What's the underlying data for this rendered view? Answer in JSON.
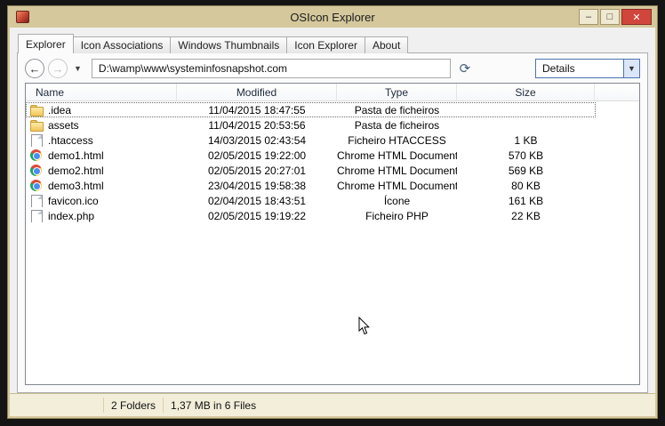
{
  "titlebar": {
    "title": "OSIcon Explorer",
    "minimize_glyph": "–",
    "maximize_glyph": "□",
    "close_glyph": "✕"
  },
  "tabs": [
    {
      "label": "Explorer",
      "active": true
    },
    {
      "label": "Icon Associations",
      "active": false
    },
    {
      "label": "Windows Thumbnails",
      "active": false
    },
    {
      "label": "Icon Explorer",
      "active": false
    },
    {
      "label": "About",
      "active": false
    }
  ],
  "toolbar": {
    "back_glyph": "←",
    "forward_glyph": "→",
    "history_dropdown_glyph": "▼",
    "address": "D:\\wamp\\www\\systeminfosnapshot.com",
    "refresh_glyph": "⟳",
    "view_combo": {
      "value": "Details",
      "arrow_glyph": "▼"
    }
  },
  "list": {
    "columns": [
      "Name",
      "Modified",
      "Type",
      "Size"
    ],
    "rows": [
      {
        "icon": "folder",
        "name": ".idea",
        "modified": "11/04/2015 18:47:55",
        "type": "Pasta de ficheiros",
        "size": "",
        "focused": true
      },
      {
        "icon": "folder",
        "name": "assets",
        "modified": "11/04/2015 20:53:56",
        "type": "Pasta de ficheiros",
        "size": "",
        "focused": false
      },
      {
        "icon": "file",
        "name": ".htaccess",
        "modified": "14/03/2015 02:43:54",
        "type": "Ficheiro HTACCESS",
        "size": "1 KB",
        "focused": false
      },
      {
        "icon": "chrome",
        "name": "demo1.html",
        "modified": "02/05/2015 19:22:00",
        "type": "Chrome HTML Document",
        "size": "570 KB",
        "focused": false
      },
      {
        "icon": "chrome",
        "name": "demo2.html",
        "modified": "02/05/2015 20:27:01",
        "type": "Chrome HTML Document",
        "size": "569 KB",
        "focused": false
      },
      {
        "icon": "chrome",
        "name": "demo3.html",
        "modified": "23/04/2015 19:58:38",
        "type": "Chrome HTML Document",
        "size": "80 KB",
        "focused": false
      },
      {
        "icon": "file",
        "name": "favicon.ico",
        "modified": "02/04/2015 18:43:51",
        "type": "Ícone",
        "size": "161 KB",
        "focused": false
      },
      {
        "icon": "file",
        "name": "index.php",
        "modified": "02/05/2015 19:19:22",
        "type": "Ficheiro PHP",
        "size": "22 KB",
        "focused": false
      }
    ]
  },
  "statusbar": {
    "panel_folders": "2 Folders",
    "panel_files": "1,37 MB in 6 Files"
  }
}
